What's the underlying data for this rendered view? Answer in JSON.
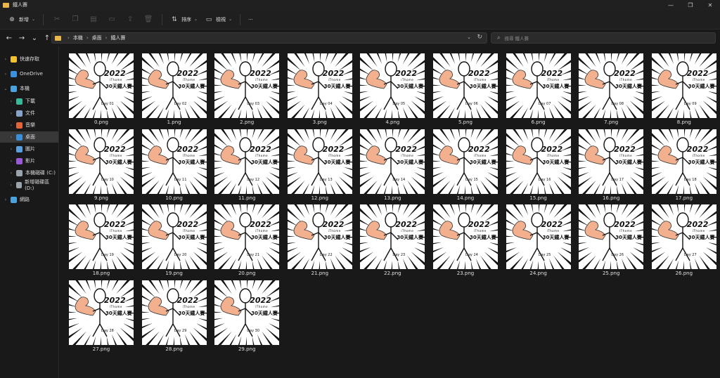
{
  "window": {
    "title": "鐵人賽",
    "controls": {
      "minimize": "—",
      "maximize": "❐",
      "close": "✕"
    }
  },
  "toolbar": {
    "new_label": "新增",
    "sort_label": "排序",
    "view_label": "檢視",
    "more_label": "···"
  },
  "address": {
    "crumbs": [
      "本機",
      "桌面",
      "鐵人賽"
    ],
    "search_placeholder": "搜尋 鐵人賽"
  },
  "sidebar": {
    "items": [
      {
        "label": "快速存取",
        "icon": "star-icon",
        "color": "#f2c12e"
      },
      {
        "label": "OneDrive",
        "icon": "cloud-icon",
        "color": "#3b8fe0"
      },
      {
        "label": "本機",
        "icon": "computer-icon",
        "color": "#4aa3df"
      },
      {
        "label": "下載",
        "icon": "download-icon",
        "color": "#3ab89a"
      },
      {
        "label": "文件",
        "icon": "document-icon",
        "color": "#8aa3c9"
      },
      {
        "label": "音樂",
        "icon": "music-icon",
        "color": "#e2643c"
      },
      {
        "label": "桌面",
        "icon": "desktop-icon",
        "color": "#3a8fd8"
      },
      {
        "label": "圖片",
        "icon": "pictures-icon",
        "color": "#5aa0e0"
      },
      {
        "label": "影片",
        "icon": "videos-icon",
        "color": "#9a5ad6"
      },
      {
        "label": "本機磁碟 (C:)",
        "icon": "drive-c-icon",
        "color": "#9aa4ad"
      },
      {
        "label": "新增磁碟區 (D:)",
        "icon": "drive-d-icon",
        "color": "#9aa4ad"
      },
      {
        "label": "網路",
        "icon": "network-icon",
        "color": "#4aa3df"
      }
    ]
  },
  "thumbnail_text": {
    "year": "2022",
    "ithome": "iThome",
    "title": "30天鐵人賽"
  },
  "files": [
    {
      "name": "0.png",
      "day": "Day 01"
    },
    {
      "name": "1.png",
      "day": "Day 02"
    },
    {
      "name": "2.png",
      "day": "Day 03"
    },
    {
      "name": "3.png",
      "day": "Day 04"
    },
    {
      "name": "4.png",
      "day": "Day 05"
    },
    {
      "name": "5.png",
      "day": "Day 06"
    },
    {
      "name": "6.png",
      "day": "Day 07"
    },
    {
      "name": "7.png",
      "day": "Day 08"
    },
    {
      "name": "8.png",
      "day": "Day 09"
    },
    {
      "name": "9.png",
      "day": "Day 10"
    },
    {
      "name": "10.png",
      "day": "Day 11"
    },
    {
      "name": "11.png",
      "day": "Day 12"
    },
    {
      "name": "12.png",
      "day": "Day 13"
    },
    {
      "name": "13.png",
      "day": "Day 14"
    },
    {
      "name": "14.png",
      "day": "Day 15"
    },
    {
      "name": "15.png",
      "day": "Day 16"
    },
    {
      "name": "16.png",
      "day": "Day 17"
    },
    {
      "name": "17.png",
      "day": "Day 18"
    },
    {
      "name": "18.png",
      "day": "Day 19"
    },
    {
      "name": "19.png",
      "day": "Day 20"
    },
    {
      "name": "20.png",
      "day": "Day 21"
    },
    {
      "name": "21.png",
      "day": "Day 22"
    },
    {
      "name": "22.png",
      "day": "Day 23"
    },
    {
      "name": "23.png",
      "day": "Day 24"
    },
    {
      "name": "24.png",
      "day": "Day 25"
    },
    {
      "name": "25.png",
      "day": "Day 26"
    },
    {
      "name": "26.png",
      "day": "Day 27"
    },
    {
      "name": "27.png",
      "day": "Day 28"
    },
    {
      "name": "28.png",
      "day": "Day 29"
    },
    {
      "name": "29.png",
      "day": "Day 30"
    }
  ]
}
